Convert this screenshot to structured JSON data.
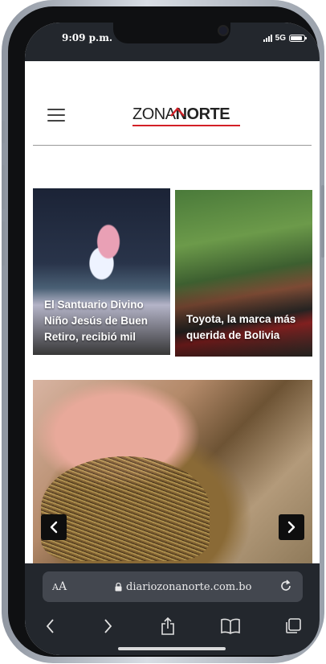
{
  "status_bar": {
    "time": "9:09 p.m.",
    "network": "5G",
    "signal_bars": 4,
    "battery_level": 0.9
  },
  "site": {
    "logo_part1": "ZONA",
    "logo_part2": "NORTE",
    "accent_color": "#d32027"
  },
  "articles": [
    {
      "title": "El Santuario Divino Niño Jesús de Buen Retiro, recibió mil"
    },
    {
      "title": "Toyota, la marca más querida de Bolivia"
    }
  ],
  "slider": {
    "prev_icon": "chevron-left-icon",
    "next_icon": "chevron-right-icon"
  },
  "browser": {
    "aa_label_big": "A",
    "aa_label_small": "A",
    "url": "diariozonanorte.com.bo",
    "toolbar_icons": [
      "back-icon",
      "forward-icon",
      "share-icon",
      "bookmarks-icon",
      "tabs-icon"
    ]
  }
}
